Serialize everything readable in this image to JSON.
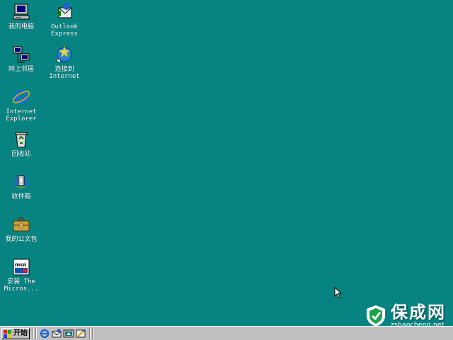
{
  "desktop": {
    "background_color": "#078482",
    "icons": [
      {
        "name": "my-computer",
        "label": "我的电脑",
        "icon": "computer-icon"
      },
      {
        "name": "outlook-express",
        "label": "Outlook\nExpress",
        "icon": "outlook-express-icon"
      },
      {
        "name": "network-neighborhood",
        "label": "网上邻居",
        "icon": "network-icon"
      },
      {
        "name": "connect-internet",
        "label": "连接到\nInternet",
        "icon": "connect-internet-icon"
      },
      {
        "name": "internet-explorer",
        "label": "Internet\nExplorer",
        "icon": "ie-icon"
      },
      {
        "name": "recycle-bin",
        "label": "回收站",
        "icon": "recycle-bin-icon"
      },
      {
        "name": "inbox",
        "label": "收件箱",
        "icon": "inbox-icon"
      },
      {
        "name": "my-briefcase",
        "label": "我的公文包",
        "icon": "briefcase-icon"
      },
      {
        "name": "install-msn",
        "label": "安装 The\nMicros...",
        "icon": "msn-icon"
      }
    ]
  },
  "taskbar": {
    "start_label": "开始",
    "quick_launch": [
      "ie-icon",
      "outlook-express-icon",
      "show-desktop-icon",
      "channels-icon"
    ]
  },
  "watermark": {
    "title": "保成网",
    "url": "zsbaocheng.net"
  }
}
